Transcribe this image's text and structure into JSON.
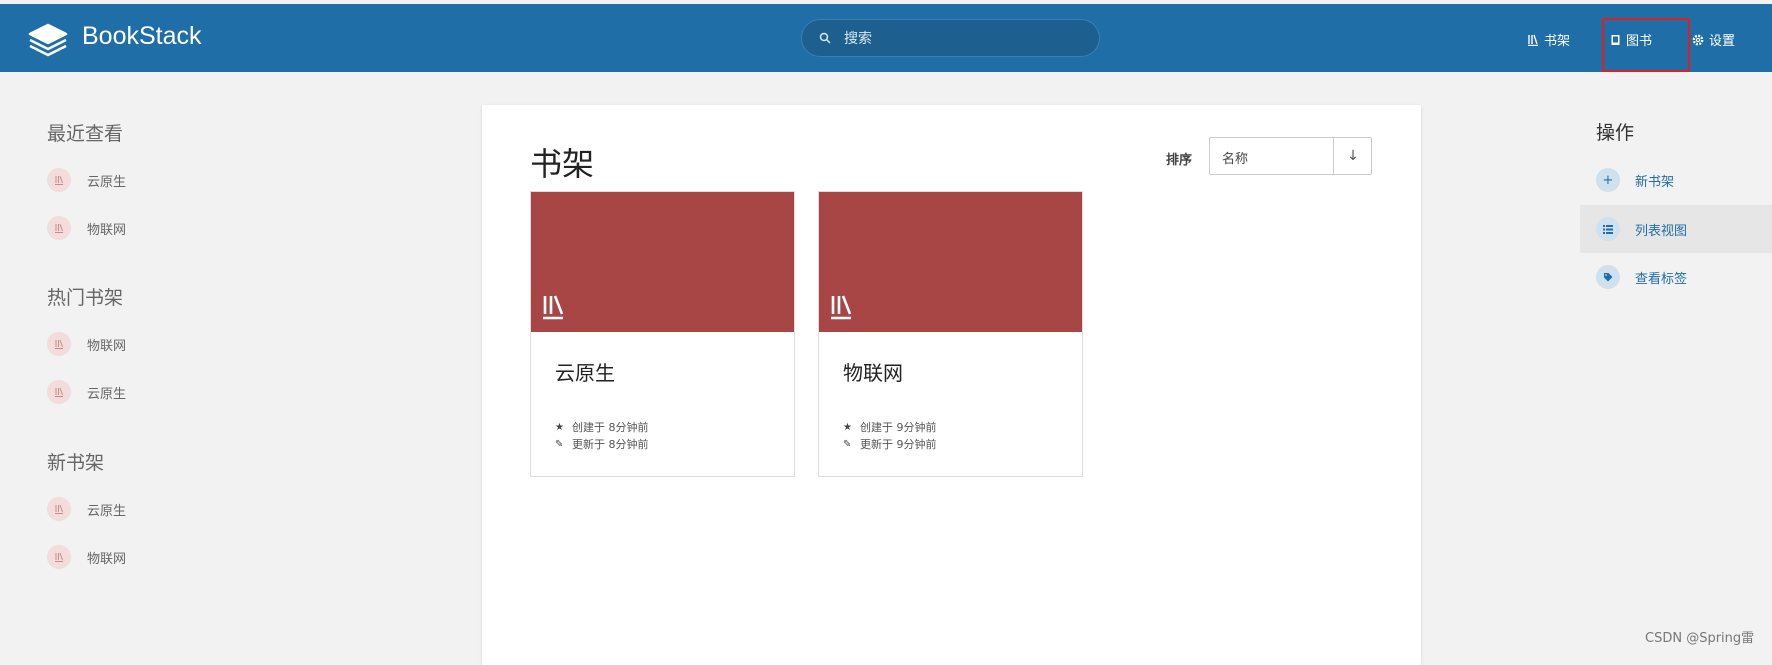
{
  "header": {
    "brand": "BookStack",
    "search_placeholder": "搜索",
    "nav": {
      "shelves": "书架",
      "books": "图书",
      "settings": "设置"
    }
  },
  "left_sidebar": {
    "recent": {
      "title": "最近查看",
      "items": [
        "云原生",
        "物联网"
      ]
    },
    "popular": {
      "title": "热门书架",
      "items": [
        "物联网",
        "云原生"
      ]
    },
    "new": {
      "title": "新书架",
      "items": [
        "云原生",
        "物联网"
      ]
    }
  },
  "main": {
    "title": "书架",
    "sort_label": "排序",
    "sort_value": "名称",
    "sort_direction": "↓",
    "shelves": [
      {
        "name": "云原生",
        "created": "创建于 8分钟前",
        "updated": "更新于 8分钟前"
      },
      {
        "name": "物联网",
        "created": "创建于 9分钟前",
        "updated": "更新于 9分钟前"
      }
    ]
  },
  "right_sidebar": {
    "title": "操作",
    "actions": [
      "新书架",
      "列表视图",
      "查看标签"
    ]
  },
  "watermark": "CSDN @Spring雷",
  "colors": {
    "header": "#206ea7",
    "shelf_cover": "#a84646",
    "highlight": "#e02020"
  }
}
